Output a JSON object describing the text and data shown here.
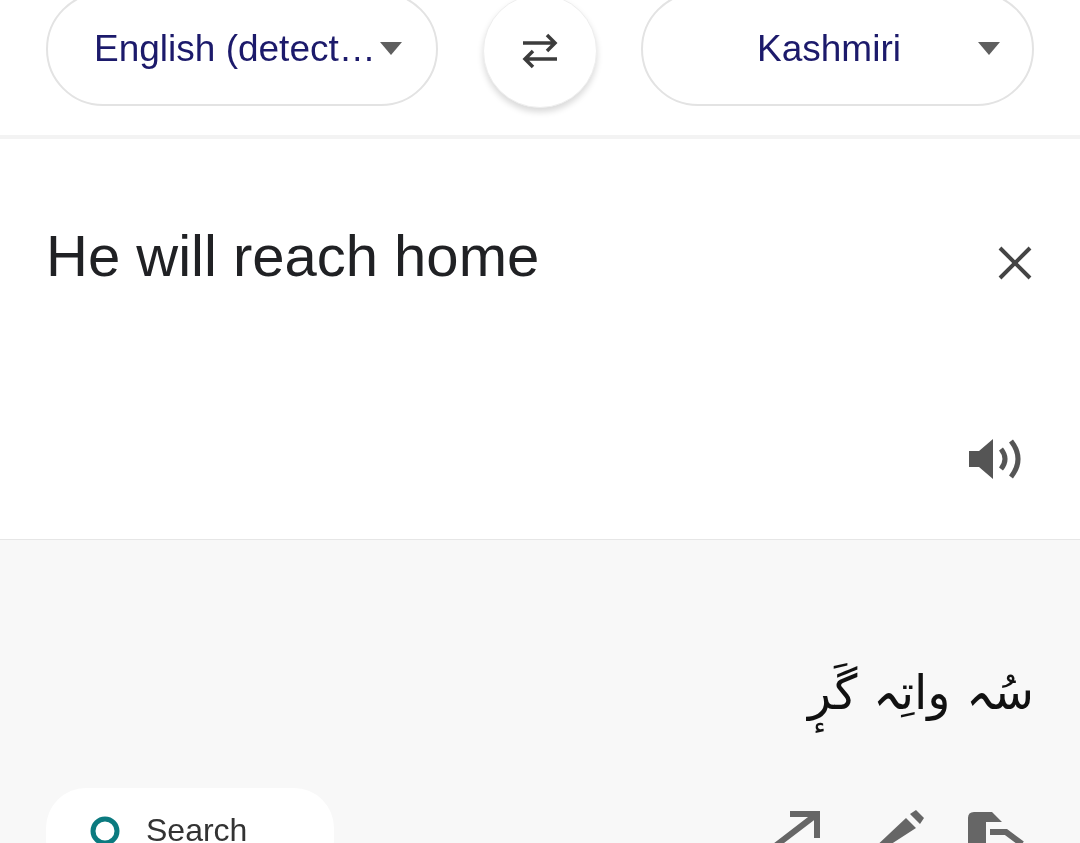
{
  "language_bar": {
    "source_language": "English (detect…",
    "target_language": "Kashmiri"
  },
  "input": {
    "value": "He will reach home"
  },
  "output": {
    "translation": "سُہ واتِہ گَرٕ"
  },
  "bottom_bar": {
    "search_label": "Search"
  }
}
